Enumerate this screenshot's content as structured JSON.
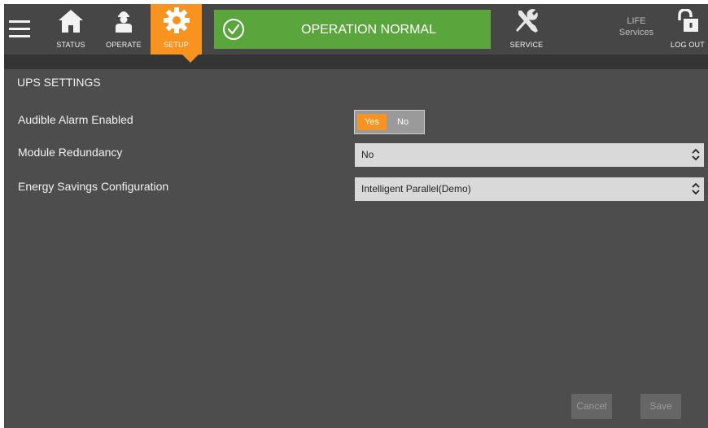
{
  "nav": {
    "status_label": "STATUS",
    "operate_label": "OPERATE",
    "setup_label": "SETUP",
    "service_label": "SERVICE",
    "life_line1": "LIFE",
    "life_line2": "Services",
    "logout_label": "LOG OUT"
  },
  "status": {
    "text": "OPERATION NORMAL",
    "color": "#5aa63c"
  },
  "accent_color": "#f7931e",
  "page": {
    "title": "UPS SETTINGS"
  },
  "settings": {
    "audible_alarm": {
      "label": "Audible Alarm Enabled",
      "yes": "Yes",
      "no": "No",
      "selected": "Yes"
    },
    "module_redundancy": {
      "label": "Module Redundancy",
      "value": "No"
    },
    "energy_savings": {
      "label": "Energy Savings Configuration",
      "value": "Intelligent Parallel(Demo)"
    }
  },
  "actions": {
    "cancel": "Cancel",
    "save": "Save"
  }
}
